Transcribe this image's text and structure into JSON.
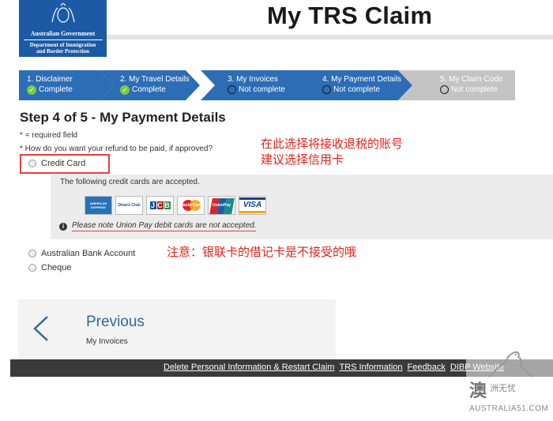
{
  "header": {
    "page_title": "My TRS Claim",
    "gov_name": "Australian Government",
    "dept_line1": "Department of Immigration",
    "dept_line2": "and Border Protection"
  },
  "steps": [
    {
      "label": "1. Disclaimer",
      "status": "Complete",
      "state": "complete"
    },
    {
      "label": "2. My Travel Details",
      "status": "Complete",
      "state": "complete"
    },
    {
      "label": "3. My Invoices",
      "status": "Not complete",
      "state": "incomplete"
    },
    {
      "label": "4. My Payment Details",
      "status": "Not complete",
      "state": "current"
    },
    {
      "label": "5. My Claim Code",
      "status": "Not complete",
      "state": "inactive"
    }
  ],
  "form": {
    "heading": "Step 4 of 5 - My Payment Details",
    "required_note": "* = required field",
    "question": "* How do you want your refund to be paid, if approved?",
    "options": {
      "credit_card": "Credit Card",
      "bank_account": "Australian Bank Account",
      "cheque": "Cheque"
    },
    "cc_accepted_text": "The following credit cards are accepted.",
    "cards": {
      "amex": "AMERICAN EXPRESS",
      "diners": "Diners Club",
      "jcb": "JCB",
      "mastercard": "MasterCard",
      "unionpay": "UnionPay",
      "visa": "VISA"
    },
    "unionpay_note": "Please note Union Pay debit cards are not accepted."
  },
  "annotations": {
    "note1_line1": "在此选择将接收退税的账号",
    "note1_line2": "建议选择信用卡",
    "note2": "注意：银联卡的借记卡是不接受的哦"
  },
  "navigation": {
    "previous_title": "Previous",
    "previous_sub": "My Invoices"
  },
  "footer": {
    "links": [
      "Delete Personal Information & Restart Claim",
      "TRS Information",
      "Feedback",
      "DIBP Website"
    ]
  },
  "watermark": {
    "glyph": "澳",
    "sub": "洲无忧",
    "site": "AUSTRALIA51.COM"
  },
  "colors": {
    "step_blue": "#2c6db5",
    "step_inactive": "#c4c4c4",
    "accent_red": "#e0231b",
    "link_blue": "#2e6b93"
  }
}
